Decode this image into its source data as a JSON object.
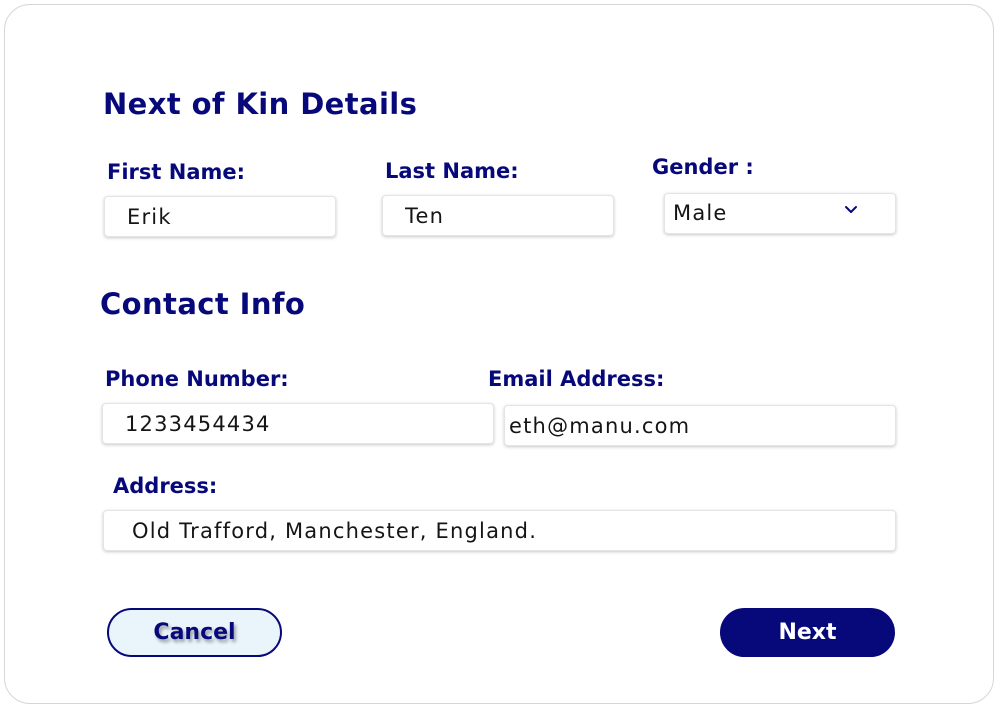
{
  "next_of_kin": {
    "title": "Next of Kin Details",
    "first_name": {
      "label": "First Name:",
      "value": "Erik"
    },
    "last_name": {
      "label": "Last Name:",
      "value": "Ten"
    },
    "gender": {
      "label": "Gender :",
      "value": "Male"
    }
  },
  "contact_info": {
    "title": "Contact Info",
    "phone": {
      "label": "Phone Number:",
      "value": "1233454434"
    },
    "email": {
      "label": "Email Address:",
      "value": "eth@manu.com"
    },
    "address": {
      "label": "Address:",
      "value": "Old Trafford, Manchester, England."
    }
  },
  "actions": {
    "cancel_label": "Cancel",
    "next_label": "Next"
  },
  "icons": {
    "gender_dropdown": "chevron-down-icon"
  },
  "colors": {
    "primary": "#07097a",
    "cancel_bg": "#e9f4fb",
    "text": "#151515",
    "card_border": "#d6d6d6"
  }
}
